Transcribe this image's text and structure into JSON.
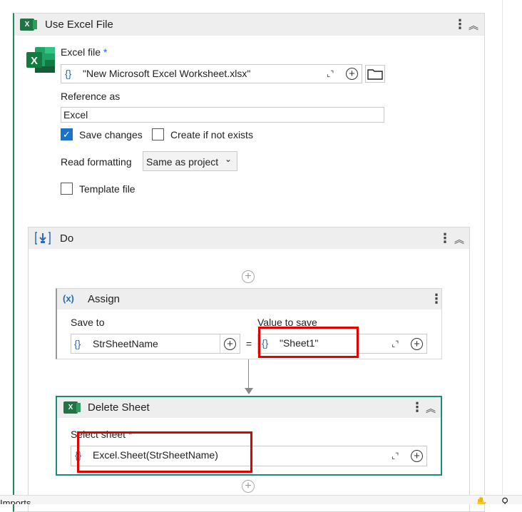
{
  "use_excel": {
    "title": "Use Excel File",
    "excel_icon_text": "X",
    "excel_file_label": "Excel file",
    "required_mark": "*",
    "file_path_value": "\"New Microsoft Excel Worksheet.xlsx\"",
    "reference_label": "Reference as",
    "reference_value": "Excel",
    "save_changes_label": "Save changes",
    "save_changes_checked": true,
    "create_if_not_exists_label": "Create if not exists",
    "read_formatting_label": "Read formatting",
    "read_formatting_value": "Same as project",
    "template_file_label": "Template file"
  },
  "do": {
    "title": "Do"
  },
  "assign": {
    "icon": "(x)",
    "title": "Assign",
    "save_to_label": "Save to",
    "save_to_value": "StrSheetName",
    "equals": "=",
    "value_label": "Value to save",
    "value_value": "\"Sheet1\""
  },
  "delete_sheet": {
    "title": "Delete Sheet",
    "select_sheet_label": "Select sheet",
    "required_mark": "*",
    "select_sheet_value": "Excel.Sheet(StrSheetName)"
  },
  "common": {
    "brace": "{}",
    "kebab": "⋮",
    "collapse": "︽",
    "plus": "+",
    "expand": "⌞⌝"
  },
  "bottom_bar": {
    "imports_label": "Imports"
  },
  "colors": {
    "accent_green": "#1e8a5a",
    "highlight_red": "#e00000",
    "brace_blue": "#2b6cb0"
  }
}
